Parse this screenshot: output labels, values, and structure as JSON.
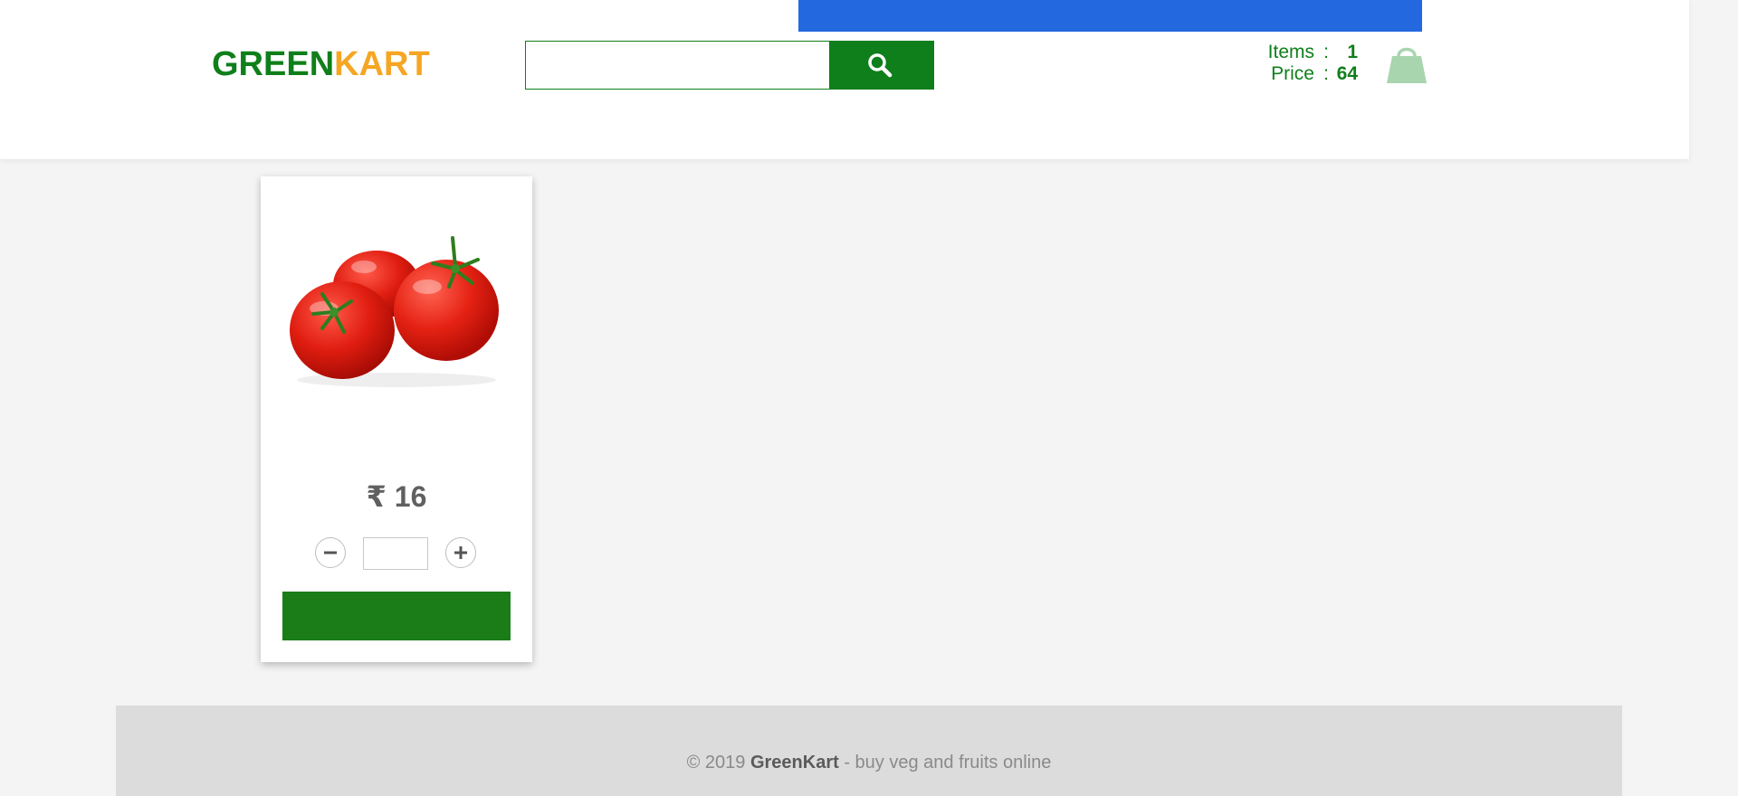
{
  "header": {
    "brand_part1": "GREEN",
    "brand_part2": "KART",
    "search": {
      "placeholder": "",
      "value": ""
    },
    "cart": {
      "items_label": "Items",
      "items_value": "1",
      "price_label": "Price",
      "price_value": "64",
      "separator": ":"
    }
  },
  "product": {
    "image_icon": "tomato-image",
    "currency": "₹",
    "price": "16",
    "price_display": "₹ 16",
    "quantity": "",
    "add_button_label": ""
  },
  "footer": {
    "copyright": "© 2019",
    "brand": "GreenKart",
    "tagline": "- buy veg and fruits online"
  },
  "colors": {
    "brand_green": "#0f7f1b",
    "brand_orange": "#f5a623",
    "banner_blue": "#2468e0",
    "button_green": "#1a7d18",
    "cart_icon": "#a8d5ae"
  }
}
